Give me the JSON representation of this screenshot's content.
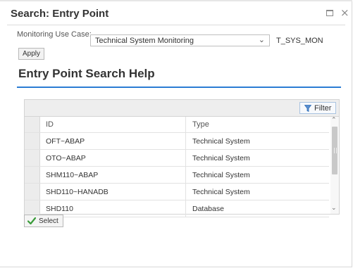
{
  "dialog": {
    "title": "Search: Entry Point"
  },
  "use_case": {
    "label": "Monitoring Use Case:",
    "selected": "Technical System Monitoring",
    "code": "T_SYS_MON",
    "apply_label": "Apply"
  },
  "section_title": "Entry Point Search Help",
  "table": {
    "filter_label": "Filter",
    "headers": {
      "id": "ID",
      "type": "Type"
    },
    "rows": [
      {
        "id": "OFT~ABAP",
        "type": "Technical System"
      },
      {
        "id": "OTO~ABAP",
        "type": "Technical System"
      },
      {
        "id": "SHM110~ABAP",
        "type": "Technical System"
      },
      {
        "id": "SHD110~HANADB",
        "type": "Technical System"
      },
      {
        "id": "SHD110",
        "type": "Database"
      }
    ]
  },
  "select_label": "Select",
  "icons": {
    "maximize": "maximize-icon",
    "close": "close-icon",
    "dropdown": "chevron-down-icon",
    "filter": "filter-icon",
    "select": "checkmark-icon"
  },
  "colors": {
    "accent": "#2b7cd3",
    "check": "#3a9c3a"
  }
}
